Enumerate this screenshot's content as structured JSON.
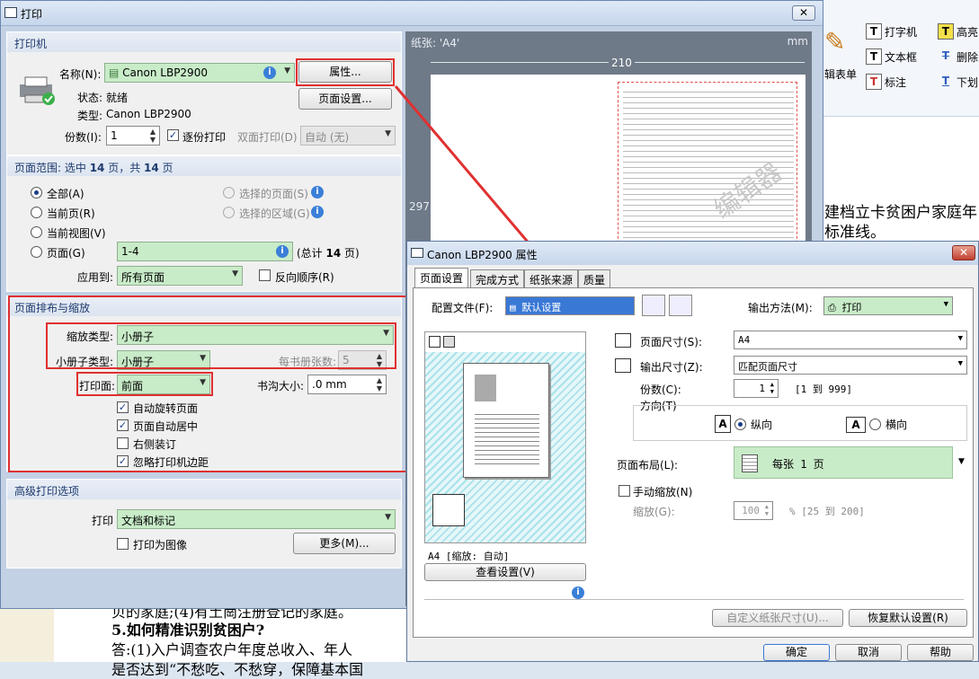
{
  "background": {
    "ribbon": {
      "label1": "打字机",
      "label2": "文本框",
      "label3": "标注",
      "label4": "高亮",
      "label5": "删除",
      "label6": "下划",
      "label7": "辑表单"
    },
    "doc_right_line1": "建档立卡贫困户家庭年",
    "doc_right_line2": "标准线。",
    "doc_bottom_line1": "贝的家庭;(4)有土崗注册登记的家庭。",
    "doc_bottom_line2": "5.如何精准识别贫困户?",
    "doc_bottom_line3": "答:(1)入户调查农户年度总收入、年人",
    "doc_bottom_line4": "是否达到“不愁吃、不愁穿，保障基本国"
  },
  "print_dialog": {
    "title": "打印",
    "printer": {
      "section": "打印机",
      "name_label": "名称(N):",
      "name_value": "Canon LBP2900",
      "properties_btn": "属性...",
      "page_setup_btn": "页面设置...",
      "status_label": "状态:",
      "status_value": "就绪",
      "type_label": "类型:",
      "type_value": "Canon LBP2900",
      "copies_label": "份数(I):",
      "copies_value": "1",
      "collate_label": "逐份打印",
      "duplex_label": "双面打印(D)",
      "duplex_value": "自动 (无)"
    },
    "range": {
      "section_pre": "页面范围: 选中 ",
      "section_count": "14",
      "section_mid": " 页，共 ",
      "section_total": "14",
      "section_post": " 页",
      "all": "全部(A)",
      "current_page": "当前页(R)",
      "current_view": "当前视图(V)",
      "pages": "页面(G)",
      "pages_value": "1-4",
      "pages_total_pre": "(总计 ",
      "pages_total_num": "14",
      "pages_total_post": " 页)",
      "selected_pages": "选择的页面(S)",
      "selected_area": "选择的区域(G)",
      "apply_label": "应用到:",
      "apply_value": "所有页面",
      "reverse_label": "反向顺序(R)"
    },
    "layout": {
      "section": "页面排布与缩放",
      "scale_type_label": "缩放类型:",
      "scale_type_value": "小册子",
      "booklet_type_label": "小册子类型:",
      "booklet_type_value": "小册子",
      "sheets_label": "每书册张数:",
      "sheets_value": "5",
      "print_side_label": "打印面:",
      "print_side_value": "前面",
      "gutter_label": "书沟大小:",
      "gutter_value": ".0 mm",
      "auto_rotate": "自动旋转页面",
      "auto_center": "页面自动居中",
      "right_binding": "右侧装订",
      "ignore_margins": "忽略打印机边距"
    },
    "advanced": {
      "section": "高级打印选项",
      "print_label": "打印",
      "print_value": "文档和标记",
      "print_as_image": "打印为图像",
      "more_btn": "更多(M)..."
    },
    "preview": {
      "paper_label": "纸张: 'A4'",
      "unit": "mm",
      "width": "210",
      "height": "297",
      "watermark": "编辑器"
    }
  },
  "properties_dialog": {
    "title": "Canon LBP2900 属性",
    "tabs": [
      "页面设置",
      "完成方式",
      "纸张来源",
      "质量"
    ],
    "profile_label": "配置文件(F):",
    "profile_value": "默认设置",
    "output_method_label": "输出方法(M):",
    "output_method_value": "打印",
    "page_size_label": "页面尺寸(S):",
    "page_size_value": "A4",
    "output_size_label": "输出尺寸(Z):",
    "output_size_value": "匹配页面尺寸",
    "copies_label": "份数(C):",
    "copies_value": "1",
    "copies_range": "[1 到 999]",
    "orientation_label": "方向(T)",
    "portrait": "纵向",
    "landscape": "横向",
    "layout_label": "页面布局(L):",
    "layout_value": "每张 1 页",
    "manual_scale_label": "手动缩放(N)",
    "scale_label": "缩放(G):",
    "scale_value": "100",
    "scale_range": "% [25 到 200]",
    "preview_caption": "A4 [缩放: 自动]",
    "view_settings_btn": "查看设置(V)",
    "custom_paper_btn": "自定义纸张尺寸(U)...",
    "restore_defaults_btn": "恢复默认设置(R)",
    "ok_btn": "确定",
    "cancel_btn": "取消",
    "help_btn": "帮助"
  }
}
